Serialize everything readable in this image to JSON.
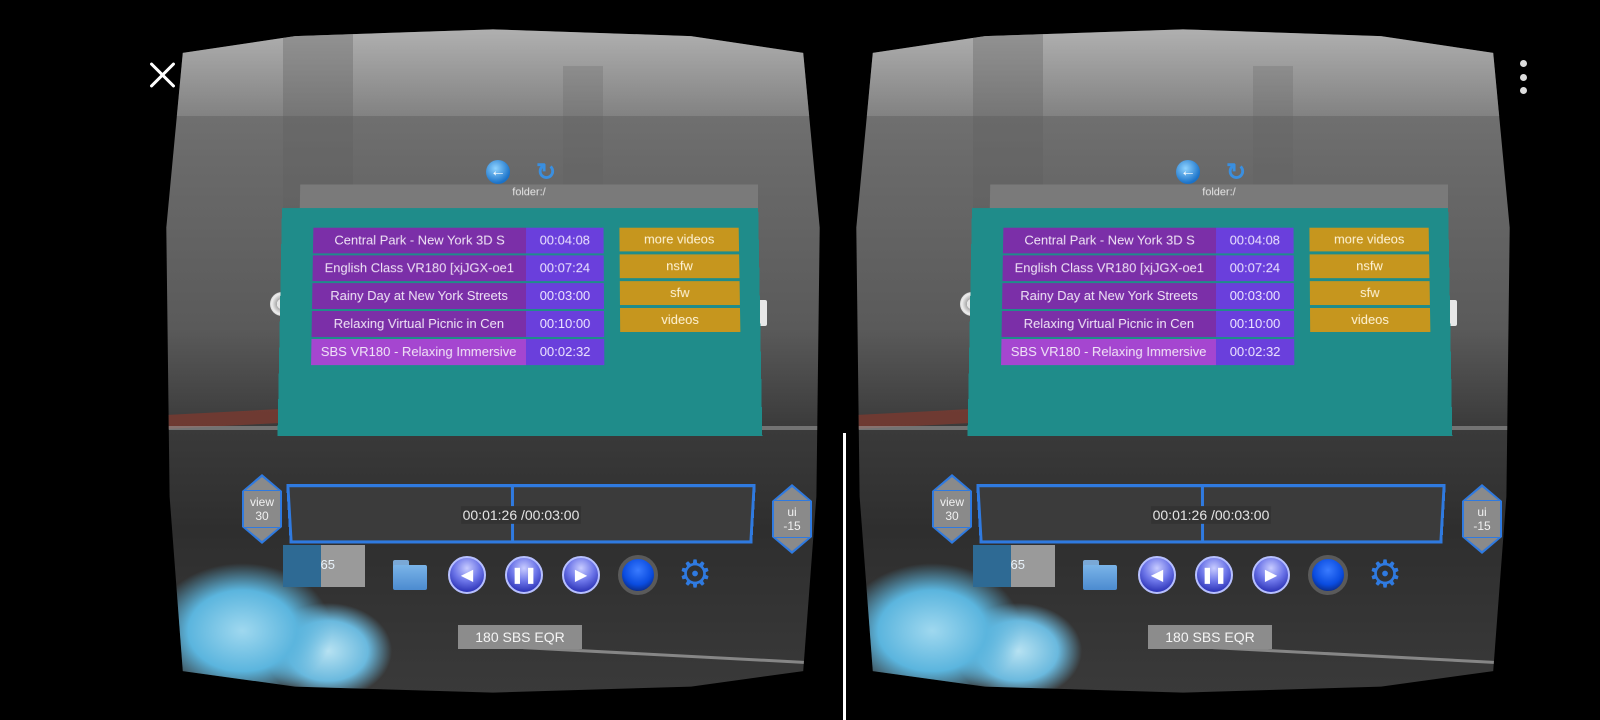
{
  "app": {
    "close_icon": "close-icon",
    "menu_icon": "more-vert-icon"
  },
  "panel": {
    "path": "folder:/",
    "back_icon": "back-arrow-icon",
    "refresh_icon": "refresh-icon",
    "files": [
      {
        "name": "Central Park - New York  3D S",
        "duration": "00:04:08"
      },
      {
        "name": "English Class VR180 [xjJGX-oe1",
        "duration": "00:07:24"
      },
      {
        "name": "Rainy Day at New York Streets",
        "duration": "00:03:00"
      },
      {
        "name": "Relaxing Virtual Picnic in Cen",
        "duration": "00:10:00"
      },
      {
        "name": "SBS VR180 - Relaxing Immersive",
        "duration": "00:02:32",
        "selected": true
      }
    ],
    "folders": [
      "more videos",
      "nsfw",
      "sfw",
      "videos"
    ]
  },
  "player": {
    "current_time": "00:01:26",
    "total_time": "00:03:00",
    "time_display": "00:01:26 /00:03:00",
    "progress_fraction": 0.478,
    "view_control": {
      "label": "view",
      "value": "30"
    },
    "ui_control": {
      "label": "ui",
      "value": "-15"
    },
    "volume": {
      "value": "65",
      "fraction": 0.65
    },
    "controls": [
      "folder-icon",
      "previous-icon",
      "pause-icon",
      "next-icon",
      "record-icon",
      "settings-icon"
    ],
    "mode": "180 SBS EQR"
  },
  "colors": {
    "panel_bg": "#1f8c8a",
    "file_name_bg": "#7b2fa8",
    "file_selected_bg": "#a546d0",
    "duration_bg": "#6a3fdc",
    "folder_bg": "#c6961e",
    "accent_blue": "#2f7ae0"
  }
}
